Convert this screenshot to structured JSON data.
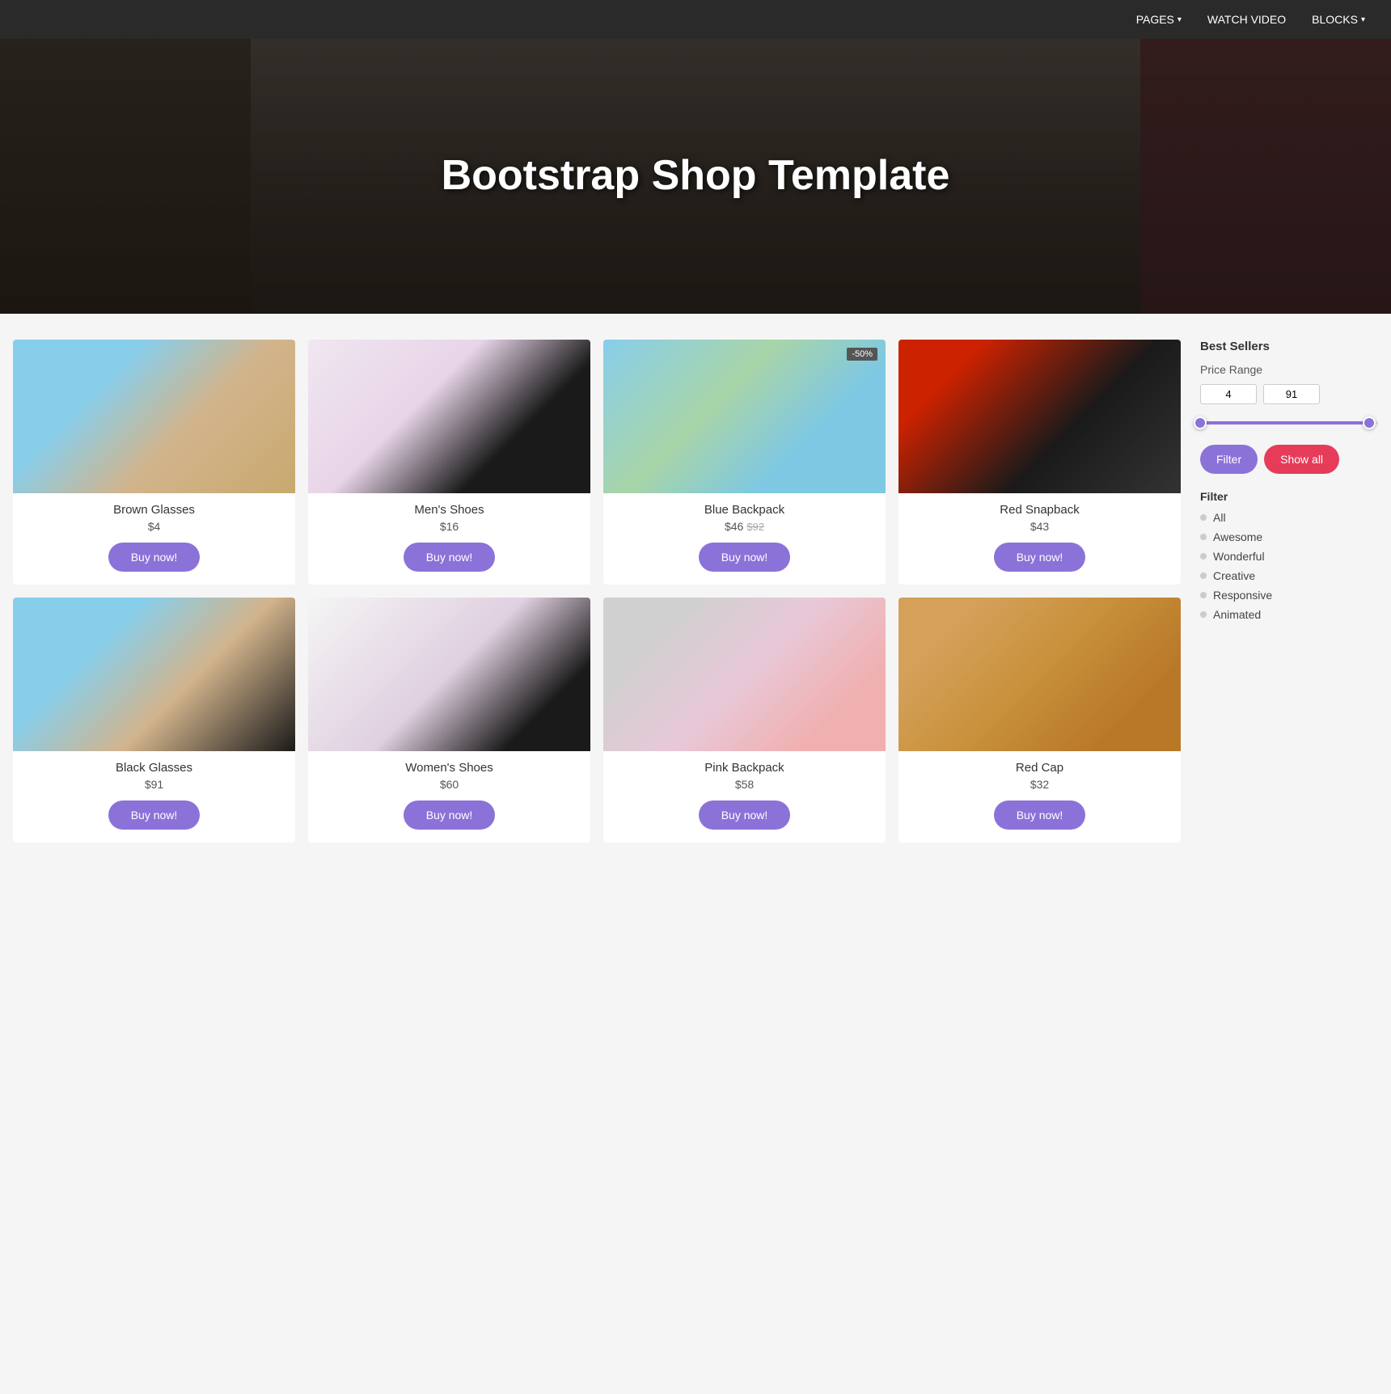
{
  "navbar": {
    "items": [
      {
        "label": "PAGES",
        "hasDropdown": true
      },
      {
        "label": "WATCH VIDEO",
        "hasDropdown": false
      },
      {
        "label": "BLOCKS",
        "hasDropdown": true
      }
    ]
  },
  "hero": {
    "title": "Bootstrap Shop Template"
  },
  "products": [
    {
      "id": "brown-glasses",
      "name": "Brown Glasses",
      "price": "$4",
      "originalPrice": null,
      "discount": null,
      "imgClass": "img-brown-glasses"
    },
    {
      "id": "mens-shoes",
      "name": "Men's Shoes",
      "price": "$16",
      "originalPrice": null,
      "discount": null,
      "imgClass": "img-mens-shoes"
    },
    {
      "id": "blue-backpack",
      "name": "Blue Backpack",
      "price": "$46",
      "originalPrice": "$92",
      "discount": "-50%",
      "imgClass": "img-blue-backpack"
    },
    {
      "id": "red-snapback",
      "name": "Red Snapback",
      "price": "$43",
      "originalPrice": null,
      "discount": null,
      "imgClass": "img-red-snapback"
    },
    {
      "id": "black-glasses",
      "name": "Black Glasses",
      "price": "$91",
      "originalPrice": null,
      "discount": null,
      "imgClass": "img-black-glasses"
    },
    {
      "id": "womens-shoes",
      "name": "Women's Shoes",
      "price": "$60",
      "originalPrice": null,
      "discount": null,
      "imgClass": "img-womens-shoes"
    },
    {
      "id": "pink-backpack",
      "name": "Pink Backpack",
      "price": "$58",
      "originalPrice": null,
      "discount": null,
      "imgClass": "img-pink-backpack"
    },
    {
      "id": "red-cap",
      "name": "Red Cap",
      "price": "$32",
      "originalPrice": null,
      "discount": null,
      "imgClass": "img-red-cap"
    }
  ],
  "sidebar": {
    "best_sellers_label": "Best Sellers",
    "price_range_label": "Price Range",
    "price_min": "4",
    "price_max": "91",
    "filter_button_label": "Filter",
    "show_all_button_label": "Show all",
    "filter_section_label": "Filter",
    "filter_items": [
      {
        "label": "All"
      },
      {
        "label": "Awesome"
      },
      {
        "label": "Wonderful"
      },
      {
        "label": "Creative"
      },
      {
        "label": "Responsive"
      },
      {
        "label": "Animated"
      }
    ]
  }
}
